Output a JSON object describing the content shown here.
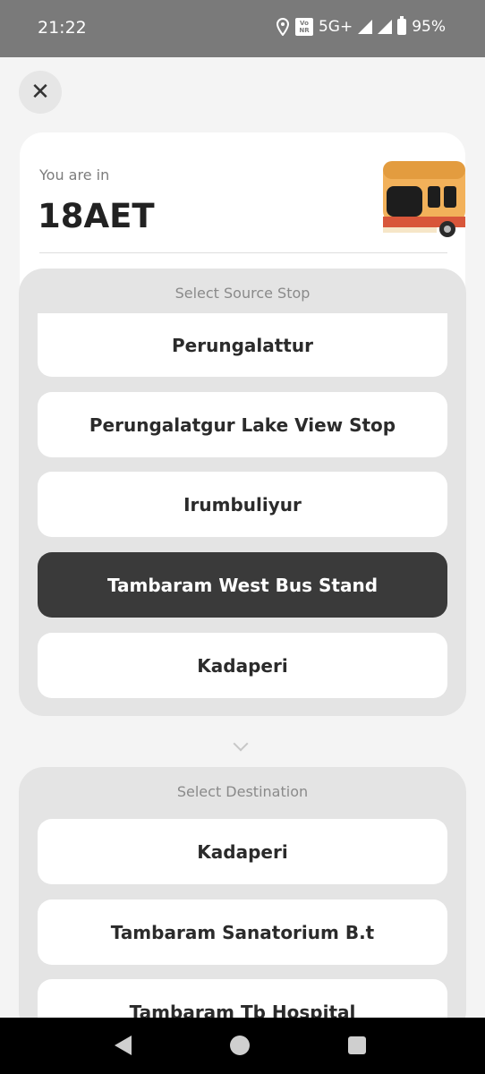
{
  "status_bar": {
    "time": "21:22",
    "volte": "Vo NR",
    "network": "5G+",
    "battery": "95%"
  },
  "header": {
    "close_icon": "close-icon"
  },
  "route_card": {
    "label": "You are in",
    "route": "18AET",
    "image": "bus-icon"
  },
  "source": {
    "title": "Select Source Stop",
    "stops": [
      "Perungalattur",
      "Perungalatgur Lake View Stop",
      "Irumbuliyur",
      "Tambaram West Bus Stand",
      "Kadaperi"
    ],
    "selected": "Tambaram West Bus Stand"
  },
  "destination": {
    "title": "Select Destination",
    "stops": [
      "Kadaperi",
      "Tambaram Sanatorium B.t",
      "Tambaram Tb Hospital"
    ]
  },
  "colors": {
    "selected_bg": "#3a3a3a",
    "panel_bg": "#e4e4e4",
    "card_bg": "#ffffff"
  }
}
